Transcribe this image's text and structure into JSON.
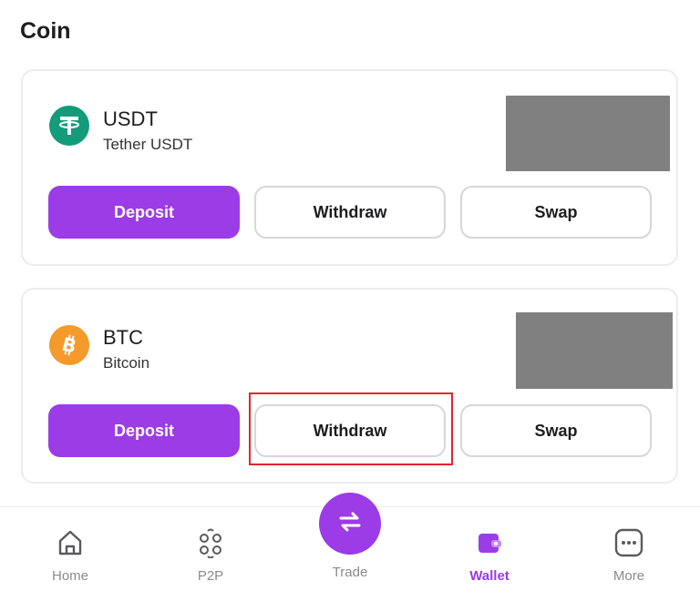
{
  "page": {
    "title": "Coin"
  },
  "coins": [
    {
      "symbol": "USDT",
      "name": "Tether USDT",
      "icon": "tether-icon",
      "icon_color": "#139c79",
      "deposit_label": "Deposit",
      "withdraw_label": "Withdraw",
      "swap_label": "Swap"
    },
    {
      "symbol": "BTC",
      "name": "Bitcoin",
      "icon": "bitcoin-icon",
      "icon_color": "#f39a2b",
      "deposit_label": "Deposit",
      "withdraw_label": "Withdraw",
      "swap_label": "Swap"
    }
  ],
  "nav": {
    "home": "Home",
    "p2p": "P2P",
    "trade": "Trade",
    "wallet": "Wallet",
    "more": "More",
    "active": "wallet"
  },
  "colors": {
    "accent": "#9b3ce6",
    "highlight": "#e3262b",
    "masked_balance": "#808080"
  }
}
